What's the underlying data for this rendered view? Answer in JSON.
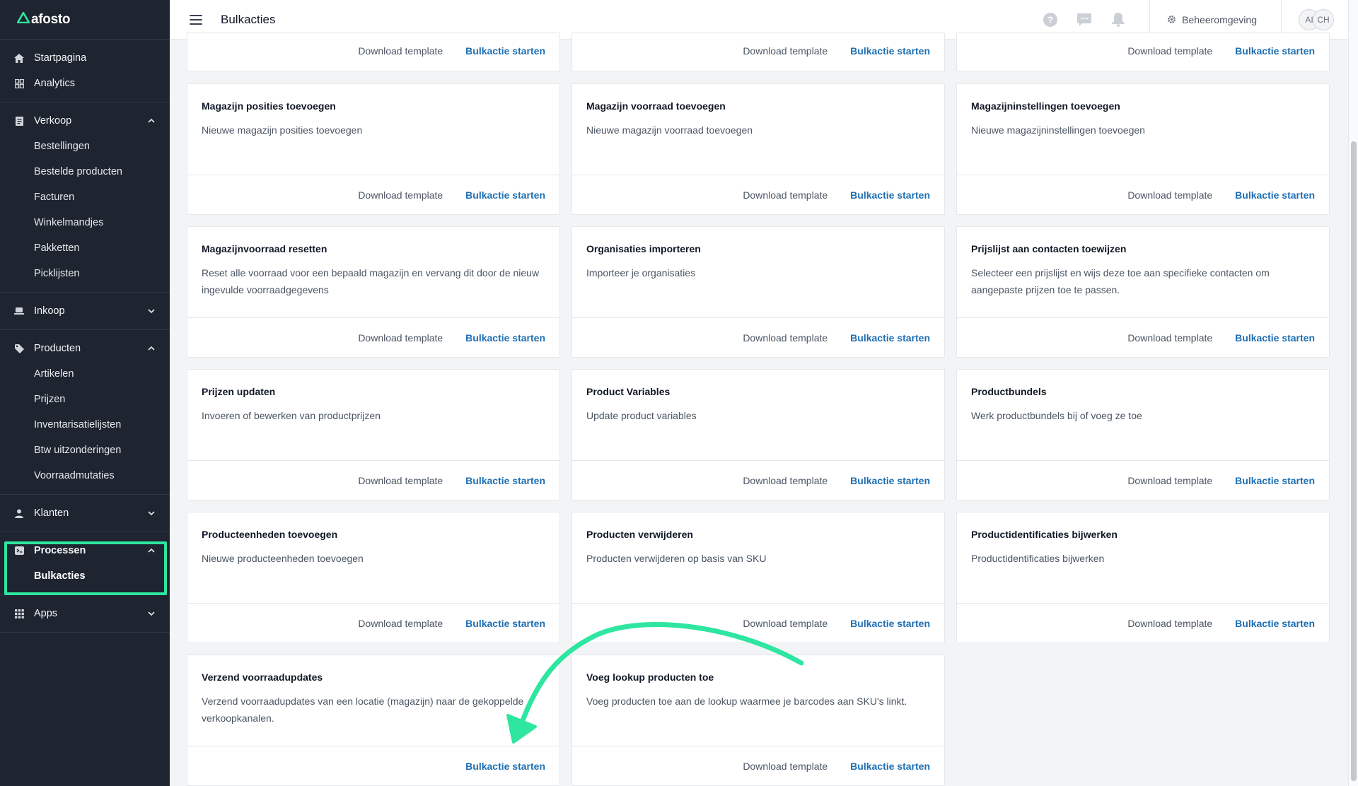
{
  "app": {
    "logo_text": "afosto",
    "page_title": "Bulkacties"
  },
  "topbar": {
    "icons": [
      "help-icon",
      "chat-icon",
      "bell-icon"
    ],
    "environment_label": "Beheeromgeving",
    "avatars": [
      "AI",
      "CH"
    ]
  },
  "sidebar": {
    "startpagina": "Startpagina",
    "analytics": "Analytics",
    "verkoop": "Verkoop",
    "verkoop_items": [
      "Bestellingen",
      "Bestelde producten",
      "Facturen",
      "Winkelmandjes",
      "Pakketten",
      "Picklijsten"
    ],
    "inkoop": "Inkoop",
    "producten": "Producten",
    "producten_items": [
      "Artikelen",
      "Prijzen",
      "Inventarisatielijsten",
      "Btw uitzonderingen",
      "Voorraadmutaties"
    ],
    "klanten": "Klanten",
    "processen": "Processen",
    "processen_items": [
      "Bulkacties"
    ],
    "apps": "Apps"
  },
  "buttons": {
    "download": "Download template",
    "start": "Bulkactie starten"
  },
  "cards": [
    {
      "title": "Magazijn posities toevoegen",
      "desc": "Nieuwe magazijn posities toevoegen"
    },
    {
      "title": "Magazijn voorraad toevoegen",
      "desc": "Nieuwe magazijn voorraad toevoegen"
    },
    {
      "title": "Magazijninstellingen toevoegen",
      "desc": "Nieuwe magazijninstellingen toevoegen"
    },
    {
      "title": "Magazijnvoorraad resetten",
      "desc": "Reset alle voorraad voor een bepaald magazijn en vervang dit door de nieuw ingevulde voorraadgegevens"
    },
    {
      "title": "Organisaties importeren",
      "desc": "Importeer je organisaties"
    },
    {
      "title": "Prijslijst aan contacten toewijzen",
      "desc": "Selecteer een prijslijst en wijs deze toe aan specifieke contacten om aangepaste prijzen toe te passen."
    },
    {
      "title": "Prijzen updaten",
      "desc": "Invoeren of bewerken van productprijzen"
    },
    {
      "title": "Product Variables",
      "desc": "Update product variables"
    },
    {
      "title": "Productbundels",
      "desc": "Werk productbundels bij of voeg ze toe"
    },
    {
      "title": "Producteenheden toevoegen",
      "desc": "Nieuwe producteenheden toevoegen"
    },
    {
      "title": "Producten verwijderen",
      "desc": "Producten verwijderen op basis van SKU"
    },
    {
      "title": "Productidentificaties bijwerken",
      "desc": "Productidentificaties bijwerken"
    },
    {
      "title": "Verzend voorraadupdates",
      "desc": "Verzend voorraadupdates van een locatie (magazijn) naar de gekoppelde verkoopkanalen."
    },
    {
      "title": "Voeg lookup producten toe",
      "desc": "Voeg producten toe aan de lookup waarmee je barcodes aan SKU's linkt."
    }
  ],
  "colors": {
    "sidebar_bg": "#1e2530",
    "accent_green": "#2ee6a0",
    "link_blue": "#1e6fb3"
  }
}
